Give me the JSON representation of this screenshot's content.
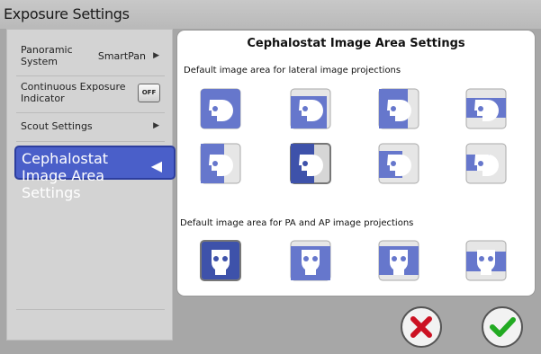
{
  "window": {
    "title": "Exposure Settings"
  },
  "sidebar": {
    "items": [
      {
        "label": "Panoramic System",
        "value": "SmartPan"
      },
      {
        "label": "Continuous Exposure Indicator",
        "toggle": "OFF"
      },
      {
        "label": "Scout Settings"
      },
      {
        "label": "Cephalostat Image Area Settings",
        "selected": true
      }
    ]
  },
  "panel": {
    "title": "Cephalostat Image Area Settings",
    "lateral_heading": "Default image area for lateral image projections",
    "pa_heading": "Default image area for PA and AP image projections"
  },
  "colors": {
    "accent": "#4a5fc9",
    "cancel": "#cc1122",
    "ok": "#22aa22"
  }
}
